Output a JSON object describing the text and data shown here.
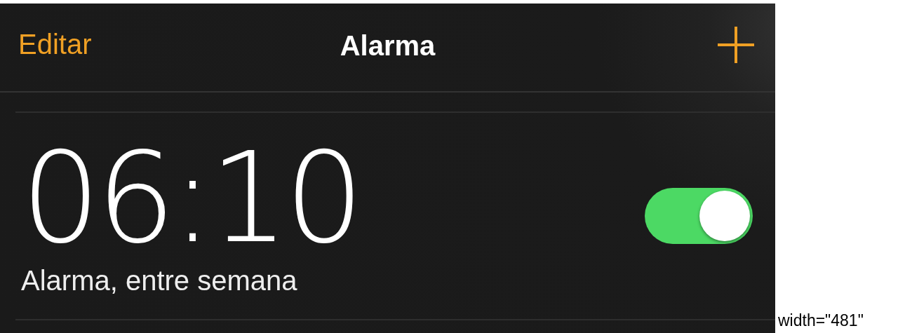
{
  "nav": {
    "edit": "Editar",
    "title": "Alarma"
  },
  "alarms": [
    {
      "time": "06:10",
      "label": "Alarma, entre semana",
      "on": true
    }
  ],
  "caption": "width=\"481\""
}
